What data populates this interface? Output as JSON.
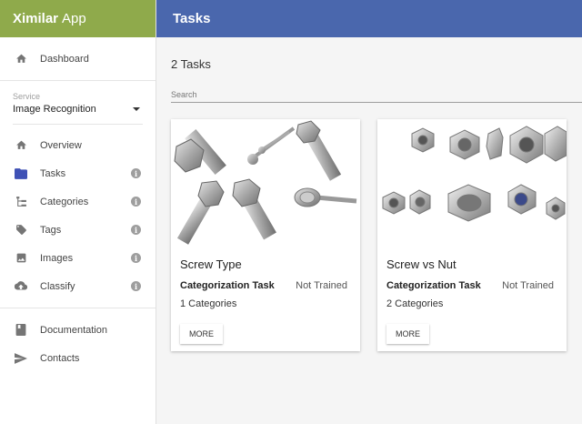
{
  "brand": {
    "bold": "Ximilar",
    "rest": "App"
  },
  "nav_top": [
    {
      "label": "Dashboard",
      "icon": "home-icon"
    }
  ],
  "service": {
    "label": "Service",
    "value": "Image Recognition"
  },
  "nav_main": [
    {
      "label": "Overview",
      "icon": "home-icon"
    },
    {
      "label": "Tasks",
      "icon": "folder-icon"
    },
    {
      "label": "Categories",
      "icon": "hierarchy-icon"
    },
    {
      "label": "Tags",
      "icon": "tag-icon"
    },
    {
      "label": "Images",
      "icon": "image-icon"
    },
    {
      "label": "Classify",
      "icon": "cloud-upload-icon"
    }
  ],
  "nav_bottom": [
    {
      "label": "Documentation",
      "icon": "book-icon"
    },
    {
      "label": "Contacts",
      "icon": "send-icon"
    }
  ],
  "header": {
    "title": "Tasks"
  },
  "main": {
    "count": "2 Tasks",
    "search_placeholder": "Search",
    "cards": [
      {
        "title": "Screw Type",
        "type": "Categorization Task",
        "status": "Not Trained",
        "categories": "1 Categories",
        "button": "MORE"
      },
      {
        "title": "Screw vs Nut",
        "type": "Categorization Task",
        "status": "Not Trained",
        "categories": "2 Categories",
        "button": "MORE"
      }
    ]
  },
  "colors": {
    "brand": "#8faa4b",
    "header": "#4a67ad",
    "folder": "#3f51b5"
  }
}
